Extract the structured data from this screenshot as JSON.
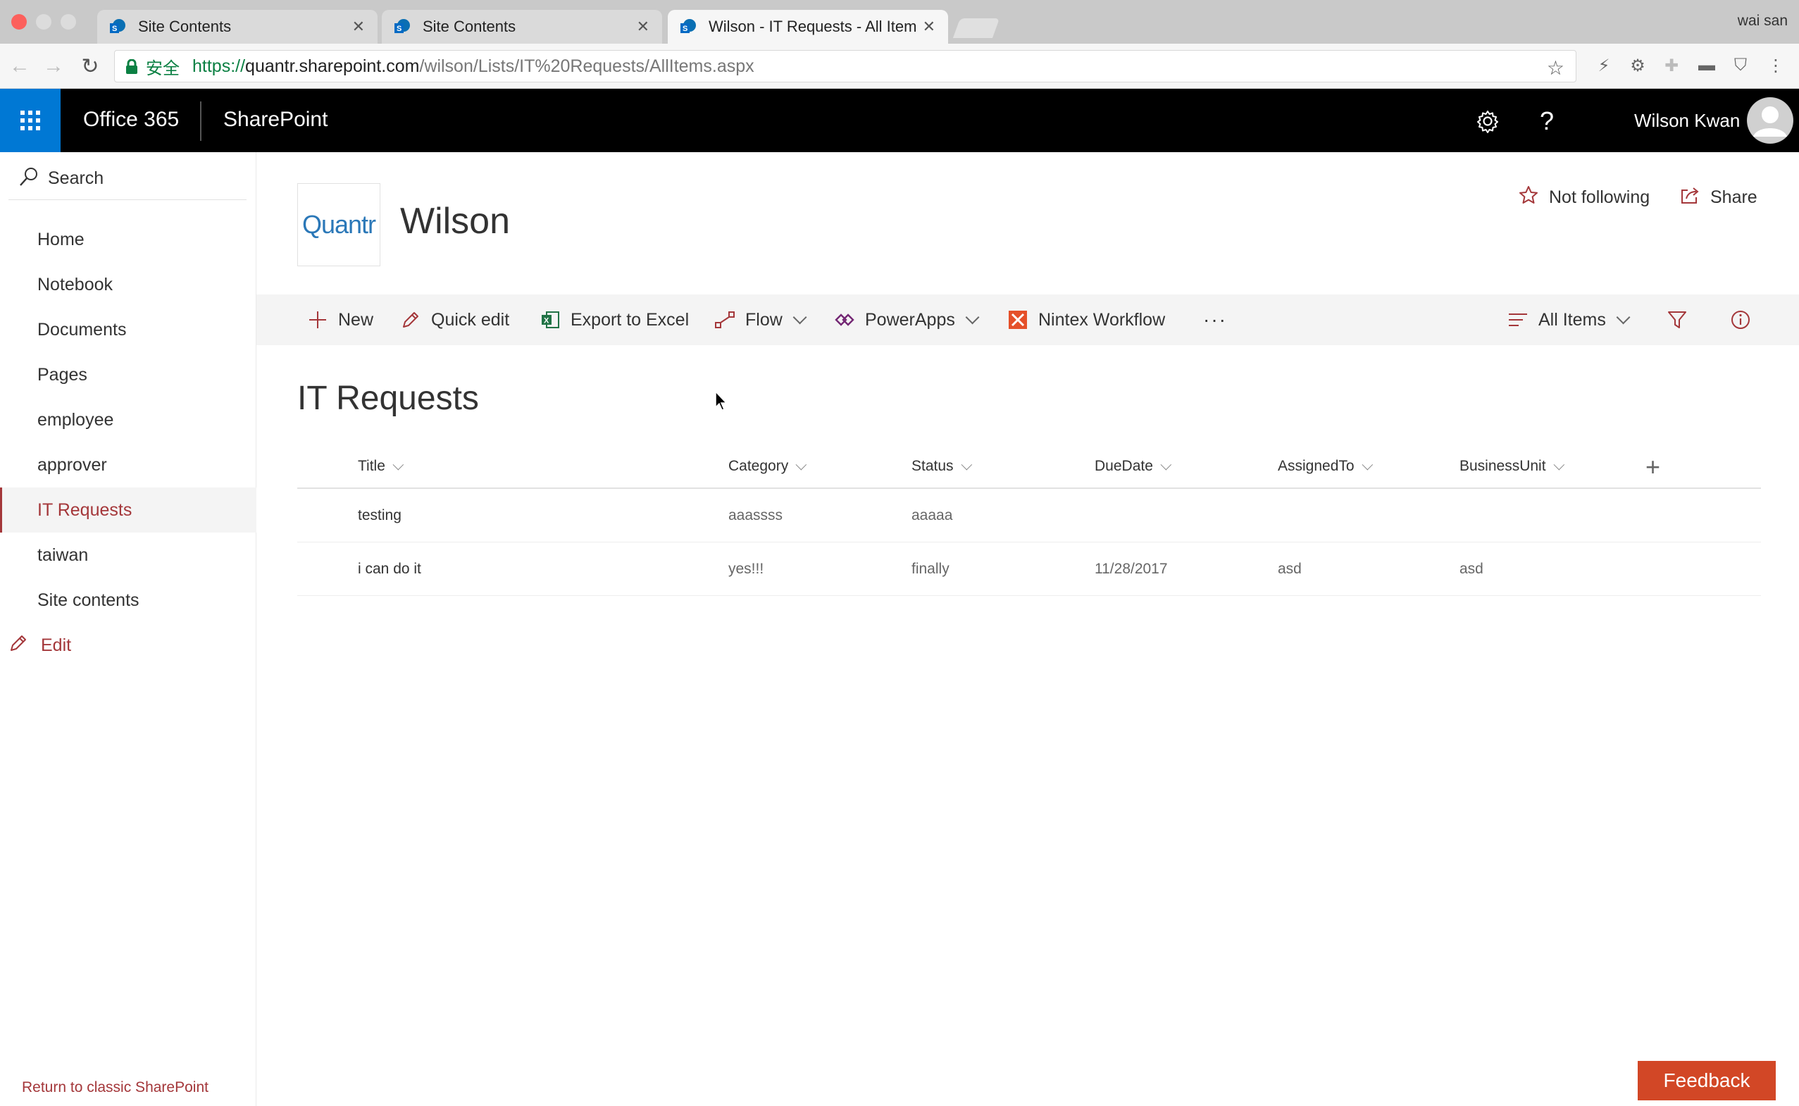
{
  "browser": {
    "tabs": [
      {
        "title": "Site Contents",
        "active": false
      },
      {
        "title": "Site Contents",
        "active": false
      },
      {
        "title": "Wilson - IT Requests - All Items",
        "active": true
      }
    ],
    "profile": "wai san",
    "secure_label": "安全",
    "url_scheme": "https://",
    "url_host": "quantr.sharepoint.com",
    "url_path": "/wilson/Lists/IT%20Requests/AllItems.aspx"
  },
  "suite": {
    "brand": "Office 365",
    "app": "SharePoint",
    "settings_icon": "gear-icon",
    "help_label": "?",
    "user_name": "Wilson Kwan"
  },
  "leftnav": {
    "search_label": "Search",
    "items": [
      {
        "label": "Home",
        "selected": false
      },
      {
        "label": "Notebook",
        "selected": false
      },
      {
        "label": "Documents",
        "selected": false
      },
      {
        "label": "Pages",
        "selected": false
      },
      {
        "label": "employee",
        "selected": false
      },
      {
        "label": "approver",
        "selected": false
      },
      {
        "label": "IT Requests",
        "selected": true
      },
      {
        "label": "taiwan",
        "selected": false
      },
      {
        "label": "Site contents",
        "selected": false
      }
    ],
    "edit_label": "Edit",
    "return_classic": "Return to classic SharePoint"
  },
  "site": {
    "logo_text": "Quantr",
    "title": "Wilson",
    "follow_label": "Not following",
    "share_label": "Share"
  },
  "commands": {
    "new": "New",
    "quick_edit": "Quick edit",
    "export_excel": "Export to Excel",
    "flow": "Flow",
    "powerapps": "PowerApps",
    "nintex": "Nintex Workflow",
    "more": "···",
    "view": "All Items"
  },
  "list": {
    "title": "IT Requests",
    "columns": [
      "Title",
      "Category",
      "Status",
      "DueDate",
      "AssignedTo",
      "BusinessUnit"
    ],
    "rows": [
      [
        "testing",
        "aaassss",
        "aaaaa",
        "",
        "",
        ""
      ],
      [
        "i can do it",
        "yes!!!",
        "finally",
        "11/28/2017",
        "asd",
        "asd"
      ]
    ]
  },
  "feedback_label": "Feedback",
  "colors": {
    "accent": "#a4373a",
    "suite_bar": "#000000",
    "waffle": "#0078d4",
    "feedback": "#d24726",
    "logo": "#2b78b8"
  }
}
